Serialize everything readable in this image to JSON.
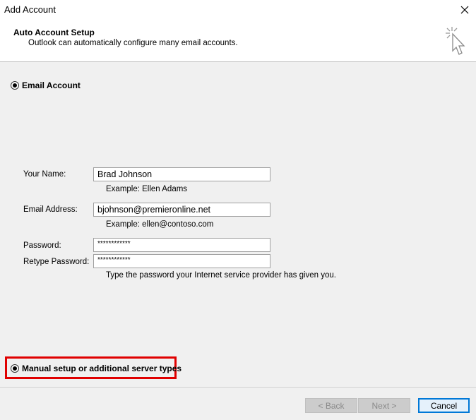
{
  "window": {
    "title": "Add Account",
    "close_icon": "close-icon"
  },
  "header": {
    "title": "Auto Account Setup",
    "subtitle": "Outlook can automatically configure many email accounts.",
    "icon": "cursor-click-icon"
  },
  "options": {
    "email_account": {
      "label": "Email Account",
      "selected": true
    },
    "manual_setup": {
      "label": "Manual setup or additional server types",
      "selected": true
    }
  },
  "form": {
    "your_name": {
      "label": "Your Name:",
      "value": "Brad Johnson",
      "hint": "Example: Ellen Adams"
    },
    "email_address": {
      "label": "Email Address:",
      "value": "bjohnson@premieronline.net",
      "hint": "Example: ellen@contoso.com"
    },
    "password": {
      "label": "Password:",
      "value": "************"
    },
    "retype_password": {
      "label": "Retype Password:",
      "value": "************",
      "hint": "Type the password your Internet service provider has given you."
    }
  },
  "buttons": {
    "back": "< Back",
    "next": "Next >",
    "cancel": "Cancel"
  },
  "colors": {
    "highlight": "#e00000",
    "default_button_border": "#0078d7"
  }
}
